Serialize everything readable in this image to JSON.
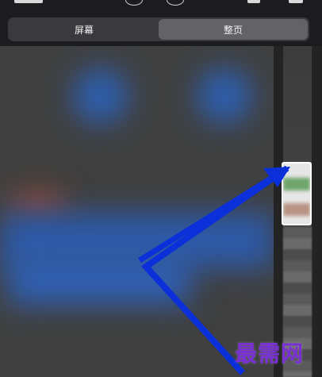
{
  "tabs": [
    {
      "label": "屏幕",
      "active": false
    },
    {
      "label": "整页",
      "active": true
    }
  ],
  "watermark": "最需网",
  "colors": {
    "segment_bg": "#3a3a3c",
    "segment_active": "#636366",
    "arrow": "#0b2fd8",
    "watermark": "#7a2fd6"
  },
  "icons": [
    "status-circle-icon",
    "status-circle-icon",
    "toolbar-icon",
    "toolbar-icon"
  ]
}
